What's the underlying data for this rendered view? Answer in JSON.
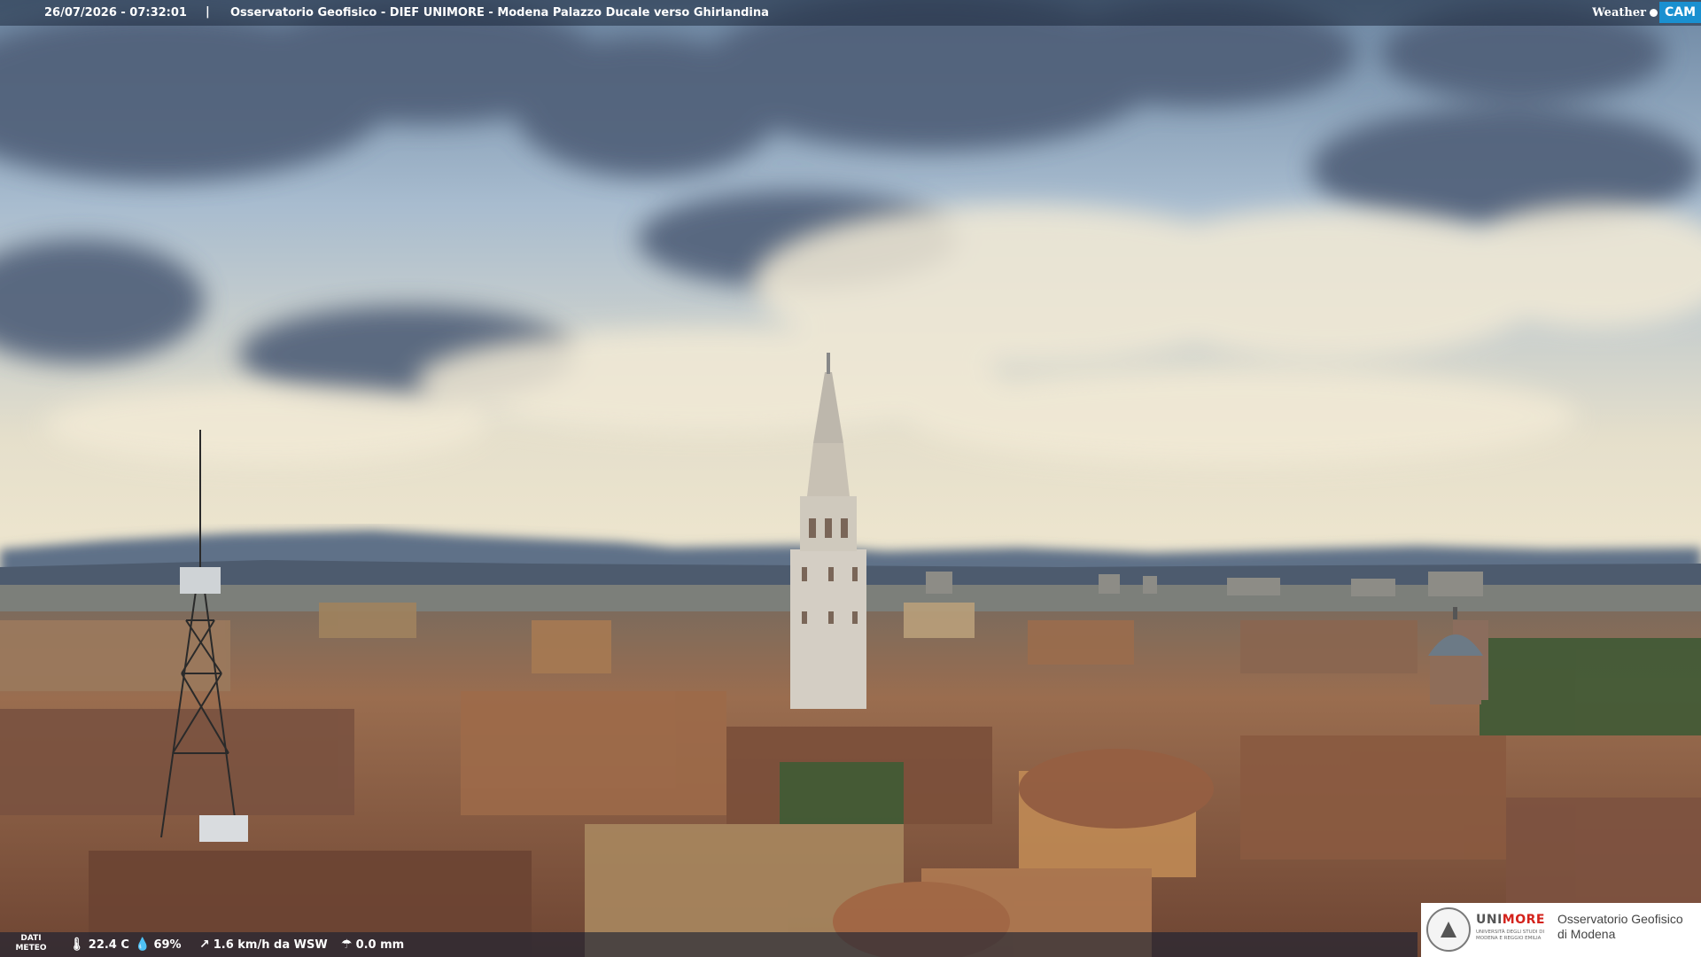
{
  "overlay": {
    "timestamp": "26/07/2026 - 07:32:01",
    "separator": "|",
    "camera_title": "Osservatorio Geofisico - DIEF UNIMORE - Modena Palazzo Ducale verso Ghirlandina",
    "brand_weather": "Weather",
    "brand_cam": "CAM"
  },
  "meteo": {
    "label_line1": "DATI",
    "label_line2": "METEO",
    "temperature": "22.4 C",
    "humidity": "69%",
    "wind": "1.6 km/h da WSW",
    "rain": "0.0 mm"
  },
  "logo": {
    "uni_part1": "UNI",
    "uni_part2": "MORE",
    "uni_small": "UNIVERSITÀ DEGLI STUDI DI MODENA E REGGIO EMILIA",
    "observatory_line1": "Osservatorio Geofisico",
    "observatory_line2": "di Modena"
  },
  "colors": {
    "sky_top": "#6d87a3",
    "sky_horizon": "#e9e1c8",
    "mountains": "#5a6b80",
    "roofs": "#8a5a40",
    "brand_blue": "#1a90d0",
    "brand_red": "#d4231c"
  }
}
